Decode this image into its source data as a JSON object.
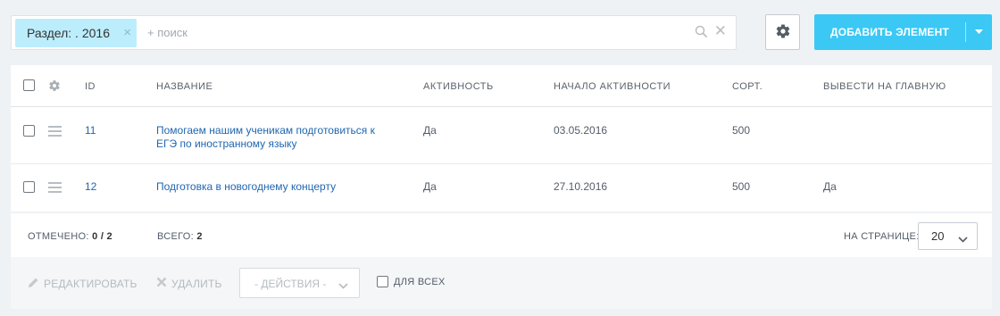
{
  "filter": {
    "chip_label": "Раздел: . 2016",
    "placeholder": "+ поиск"
  },
  "toolbar": {
    "add_label": "ДОБАВИТЬ ЭЛЕМЕНТ"
  },
  "grid": {
    "columns": {
      "id": "ID",
      "name": "НАЗВАНИЕ",
      "active": "АКТИВНОСТЬ",
      "start": "НАЧАЛО АКТИВНОСТИ",
      "sort": "СОРТ.",
      "main": "ВЫВЕСТИ НА ГЛАВНУЮ"
    },
    "rows": [
      {
        "id": "11",
        "name_line1": "Помогаем нашим ученикам подготовиться к",
        "name_line2": "ЕГЭ по иностранному языку",
        "active": "Да",
        "start": "03.05.2016",
        "sort": "500",
        "main": ""
      },
      {
        "id": "12",
        "name_line1": "Подготовка в новогоднему концерту",
        "name_line2": "",
        "active": "Да",
        "start": "27.10.2016",
        "sort": "500",
        "main": "Да"
      }
    ]
  },
  "footer": {
    "checked_label": "ОТМЕЧЕНО:",
    "checked_value": "0 / 2",
    "total_label": "ВСЕГО:",
    "total_value": "2",
    "per_page_label": "НА СТРАНИЦЕ:",
    "per_page_value": "20"
  },
  "actions": {
    "edit_label": "РЕДАКТИРОВАТЬ",
    "delete_label": "УДАЛИТЬ",
    "actions_select": "- ДЕЙСТВИЯ -",
    "for_all_label": "ДЛЯ ВСЕХ"
  },
  "colors": {
    "accent": "#3bc8f5",
    "chip": "#bcedfc",
    "link": "#2067b0",
    "background": "#eef2f4"
  },
  "icons": {
    "filter_close": "close-icon",
    "filter_search": "search-icon",
    "filter_clear": "clear-icon",
    "settings": "gear-icon",
    "add_dropdown": "chevron-down-icon",
    "row_drag": "hamburger-icon",
    "edit": "pencil-icon",
    "delete": "cross-icon"
  }
}
